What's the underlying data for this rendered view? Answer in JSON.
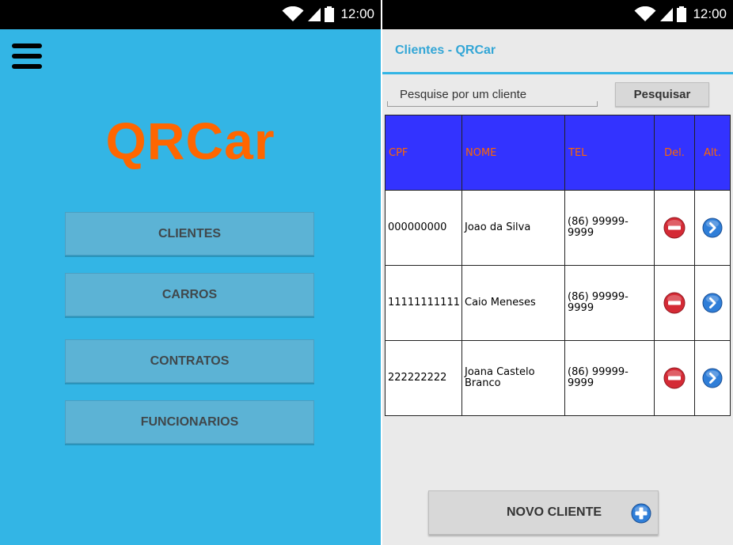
{
  "status_bar": {
    "time": "12:00"
  },
  "home": {
    "logo": "QRCar",
    "menu_items": [
      {
        "label": "CLIENTES"
      },
      {
        "label": "CARROS"
      },
      {
        "label": "CONTRATOS"
      },
      {
        "label": "FUNCIONARIOS"
      }
    ]
  },
  "clients": {
    "title": "Clientes - QRCar",
    "search": {
      "placeholder": "Pesquise por um cliente",
      "button_label": "Pesquisar"
    },
    "table": {
      "headers": {
        "cpf": "CPF",
        "nome": "NOME",
        "tel": "TEL",
        "del": "Del.",
        "alt": "Alt."
      },
      "rows": [
        {
          "cpf": "000000000",
          "nome": "Joao da Silva",
          "tel": "(86) 99999-9999"
        },
        {
          "cpf": "11111111111",
          "nome": "Caio Meneses",
          "tel": "(86) 99999-9999"
        },
        {
          "cpf": "222222222",
          "nome": "Joana Castelo Branco",
          "tel": "(86) 99999-9999"
        }
      ]
    },
    "new_client_label": "NOVO CLIENTE"
  },
  "icons": {
    "menu": "hamburger-menu-icon",
    "wifi": "wifi-icon",
    "signal": "signal-icon",
    "battery": "battery-icon",
    "delete": "minus-circle-icon",
    "edit": "chevron-right-circle-icon",
    "add": "plus-circle-icon"
  },
  "colors": {
    "home_background": "#33b5e5",
    "logo": "#ff6600",
    "menu_button": "#5cb3d5",
    "accent": "#33a6d6",
    "table_header_background": "#3333ff",
    "table_header_text": "#ff6600",
    "delete_icon": "#d42a35",
    "edit_icon": "#2f7ed8",
    "status_bar": "#000000"
  }
}
